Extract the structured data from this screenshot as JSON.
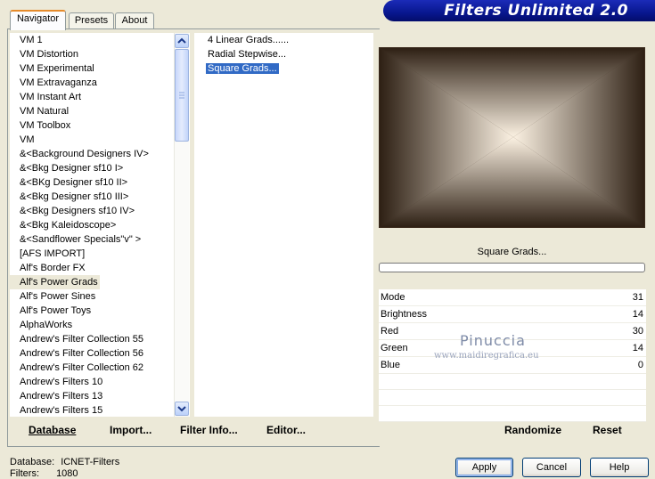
{
  "title": "Filters Unlimited 2.0",
  "tabs": [
    "Navigator",
    "Presets",
    "About"
  ],
  "categories": [
    "VM 1",
    "VM Distortion",
    "VM Experimental",
    "VM Extravaganza",
    "VM Instant Art",
    "VM Natural",
    "VM Toolbox",
    "VM",
    "&<Background Designers IV>",
    "&<Bkg Designer sf10 I>",
    "&<BKg Designer sf10 II>",
    "&<Bkg Designer sf10 III>",
    "&<Bkg Designers sf10 IV>",
    "&<Bkg Kaleidoscope>",
    "&<Sandflower Specials\"v\" >",
    "[AFS IMPORT]",
    "Alf's Border FX",
    "Alf's Power Grads",
    "Alf's Power Sines",
    "Alf's Power Toys",
    "AlphaWorks",
    "Andrew's Filter Collection 55",
    "Andrew's Filter Collection 56",
    "Andrew's Filter Collection 62",
    "Andrew's Filters 10",
    "Andrew's Filters 13",
    "Andrew's Filters 15"
  ],
  "selected_category": "Alf's Power Grads",
  "filters": [
    "4 Linear Grads......",
    "Radial Stepwise...",
    "Square Grads..."
  ],
  "selected_filter": "Square Grads...",
  "preview_filter_name": "Square Grads...",
  "progress": 0,
  "params": [
    {
      "label": "Mode",
      "value": "31"
    },
    {
      "label": "Brightness",
      "value": "14"
    },
    {
      "label": "Red",
      "value": "30"
    },
    {
      "label": "Green",
      "value": "14"
    },
    {
      "label": "Blue",
      "value": "0"
    }
  ],
  "watermark": {
    "name": "Pinuccia",
    "url": "www.maidiregrafica.eu"
  },
  "toolbar": {
    "database": "Database",
    "import": "Import...",
    "filter_info": "Filter Info...",
    "editor": "Editor...",
    "randomize": "Randomize",
    "reset": "Reset"
  },
  "status": {
    "database_label": "Database:",
    "database_value": "ICNET-Filters",
    "filters_label": "Filters:",
    "filters_value": "1080"
  },
  "buttons": {
    "apply": "Apply",
    "cancel": "Cancel",
    "help": "Help"
  },
  "colors": {
    "selection": "#316ac5",
    "dialog_bg": "#ece9d8",
    "banner": "#0a1a9a",
    "preview_dark": "#3b2b1d",
    "preview_light": "#fbf1e2"
  }
}
